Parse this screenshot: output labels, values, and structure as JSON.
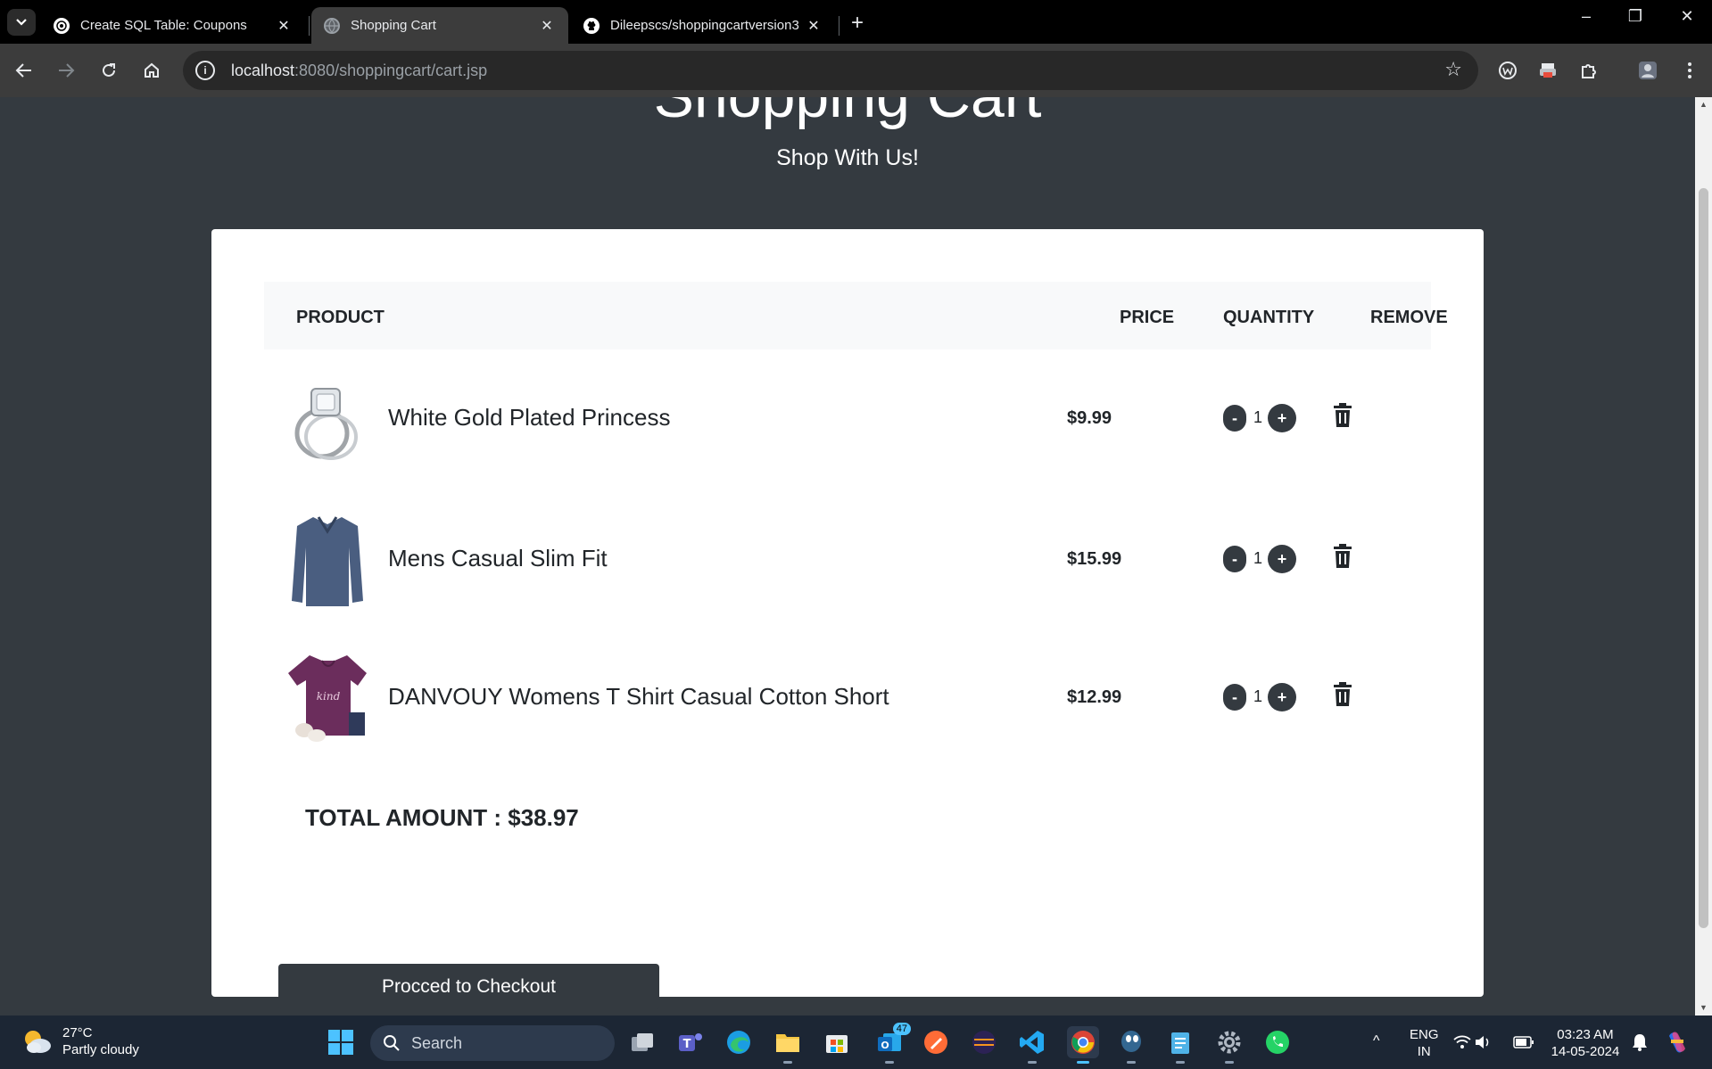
{
  "browser": {
    "tabs": [
      {
        "title": "Create SQL Table: Coupons",
        "active": false
      },
      {
        "title": "Shopping Cart",
        "active": true
      },
      {
        "title": "Dileepscs/shoppingcartversion3",
        "active": false
      }
    ],
    "url_host": "localhost",
    "url_rest": ":8080/shoppingcart/cart.jsp"
  },
  "page": {
    "title": "Shopping Cart",
    "subtitle": "Shop With Us!"
  },
  "cart": {
    "headers": {
      "product": "PRODUCT",
      "price": "PRICE",
      "quantity": "QUANTITY",
      "remove": "REMOVE"
    },
    "items": [
      {
        "name": "White Gold Plated Princess",
        "price": "$9.99",
        "qty": "1",
        "thumb": "ring"
      },
      {
        "name": "Mens Casual Slim Fit",
        "price": "$15.99",
        "qty": "1",
        "thumb": "shirt"
      },
      {
        "name": "DANVOUY Womens T Shirt Casual Cotton Short",
        "price": "$12.99",
        "qty": "1",
        "thumb": "tshirt"
      }
    ],
    "minus_label": "-",
    "plus_label": "+",
    "total_label": "TOTAL AMOUNT : $38.97",
    "checkout_label": "Procced to Checkout"
  },
  "taskbar": {
    "weather_temp": "27°C",
    "weather_desc": "Partly cloudy",
    "search_label": "Search",
    "badge_count": "47",
    "lang_line1": "ENG",
    "lang_line2": "IN",
    "time": "03:23 AM",
    "date": "14-05-2024"
  },
  "colors": {
    "page_bg": "#343a40",
    "card_bg": "#ffffff",
    "header_bg": "#f8f9fa",
    "button_bg": "#343a40"
  }
}
